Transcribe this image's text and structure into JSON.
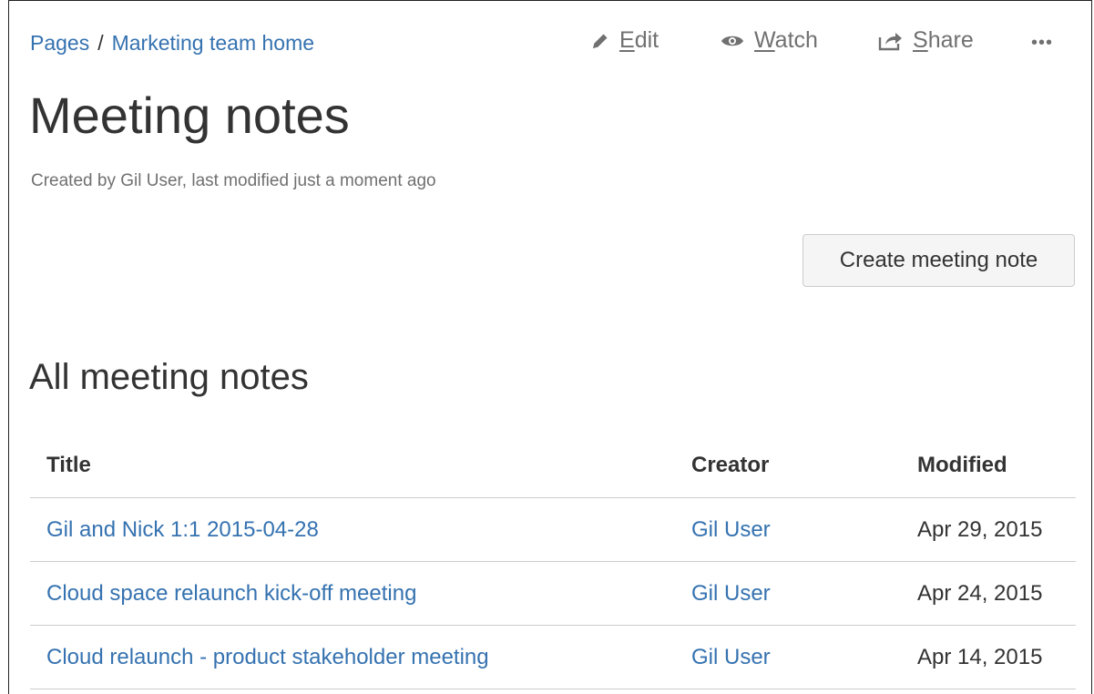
{
  "breadcrumb": {
    "items": [
      "Pages",
      "Marketing team home"
    ],
    "separator": "/"
  },
  "actions": {
    "edit": {
      "label": "Edit",
      "access_key": "E",
      "rest": "dit",
      "icon": "pencil-icon"
    },
    "watch": {
      "label": "Watch",
      "access_key": "W",
      "rest": "atch",
      "icon": "eye-icon"
    },
    "share": {
      "label": "Share",
      "access_key": "S",
      "rest": "hare",
      "icon": "share-icon"
    },
    "more": {
      "label": "•••",
      "icon": "more-icon"
    }
  },
  "page": {
    "title": "Meeting notes",
    "byline": "Created by Gil User, last modified just a moment ago"
  },
  "create_button": "Create meeting note",
  "section": {
    "heading": "All meeting notes"
  },
  "table": {
    "columns": [
      "Title",
      "Creator",
      "Modified"
    ],
    "rows": [
      {
        "title": "Gil and Nick 1:1 2015-04-28",
        "creator": "Gil User",
        "modified": "Apr 29, 2015"
      },
      {
        "title": "Cloud space relaunch kick-off meeting",
        "creator": "Gil User",
        "modified": "Apr 24, 2015"
      },
      {
        "title": "Cloud relaunch - product stakeholder meeting",
        "creator": "Gil User",
        "modified": "Apr 14, 2015"
      }
    ]
  },
  "colors": {
    "link": "#3572b0",
    "text": "#333333",
    "muted": "#707070",
    "border": "#cccccc"
  }
}
